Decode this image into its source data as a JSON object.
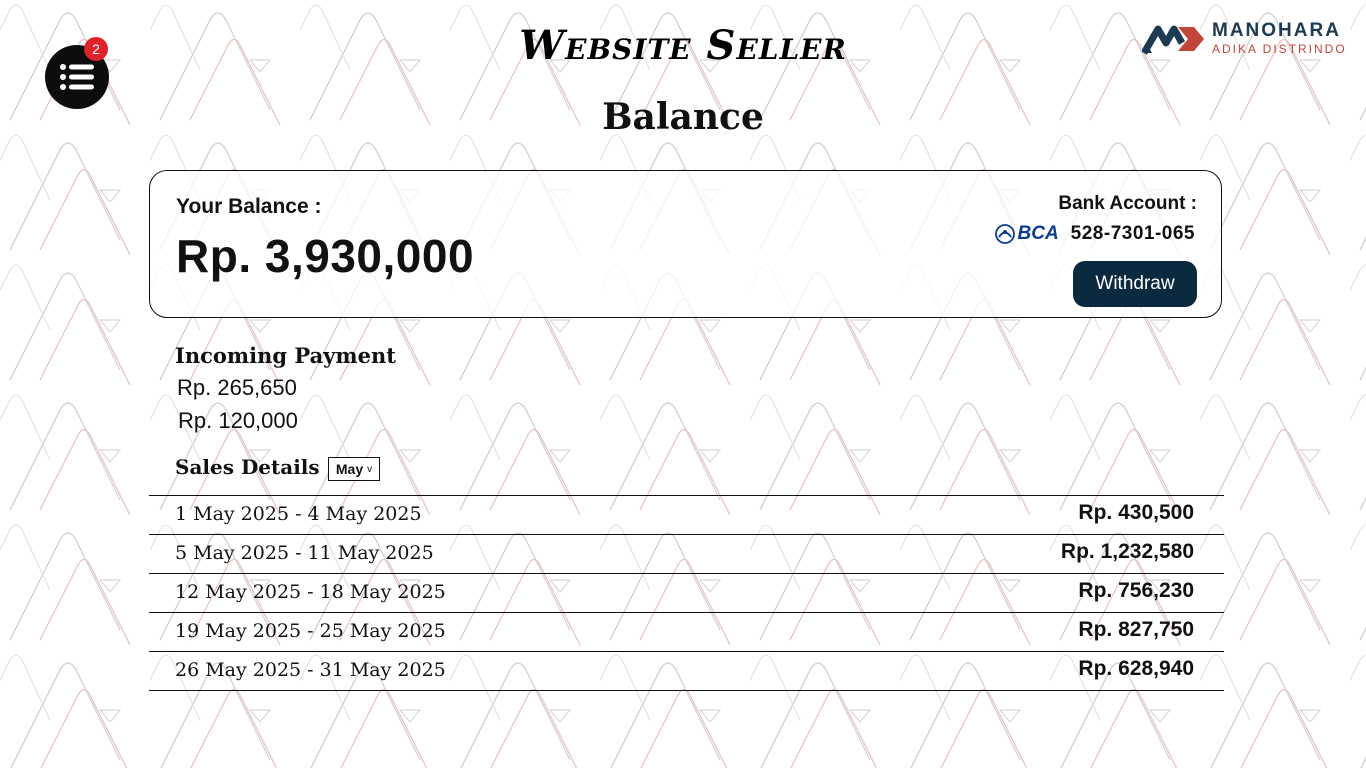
{
  "header": {
    "site_title": "Website Seller",
    "page_title": "Balance",
    "menu_badge_count": "2",
    "brand": {
      "name": "MANOHARA",
      "subtitle": "ADIKA DISTRINDO",
      "colors": {
        "primary": "#1d3a52",
        "accent": "#c0463a"
      }
    }
  },
  "balance": {
    "label": "Your Balance :",
    "amount": "Rp. 3,930,000",
    "bank_label": "Bank Account :",
    "bank_name": "BCA",
    "bank_number": "528-7301-065",
    "withdraw_label": "Withdraw"
  },
  "incoming": {
    "title": "Incoming Payment",
    "items": [
      "Rp. 265,650",
      "Rp. 120,000"
    ]
  },
  "sales": {
    "title": "Sales Details",
    "selected_month": "May",
    "rows": [
      {
        "range": "1 May 2025 - 4 May 2025",
        "amount": "Rp. 430,500"
      },
      {
        "range": "5 May 2025 - 11 May 2025",
        "amount": "Rp. 1,232,580"
      },
      {
        "range": "12 May 2025 - 18 May 2025",
        "amount": "Rp. 756,230"
      },
      {
        "range": "19 May 2025 - 25 May 2025",
        "amount": "Rp. 827,750"
      },
      {
        "range": "26 May 2025 - 31 May 2025",
        "amount": "Rp. 628,940"
      }
    ]
  },
  "colors": {
    "withdraw_button": "#0b2a40",
    "badge": "#e0222a",
    "bank_logo": "#0b3d91"
  }
}
